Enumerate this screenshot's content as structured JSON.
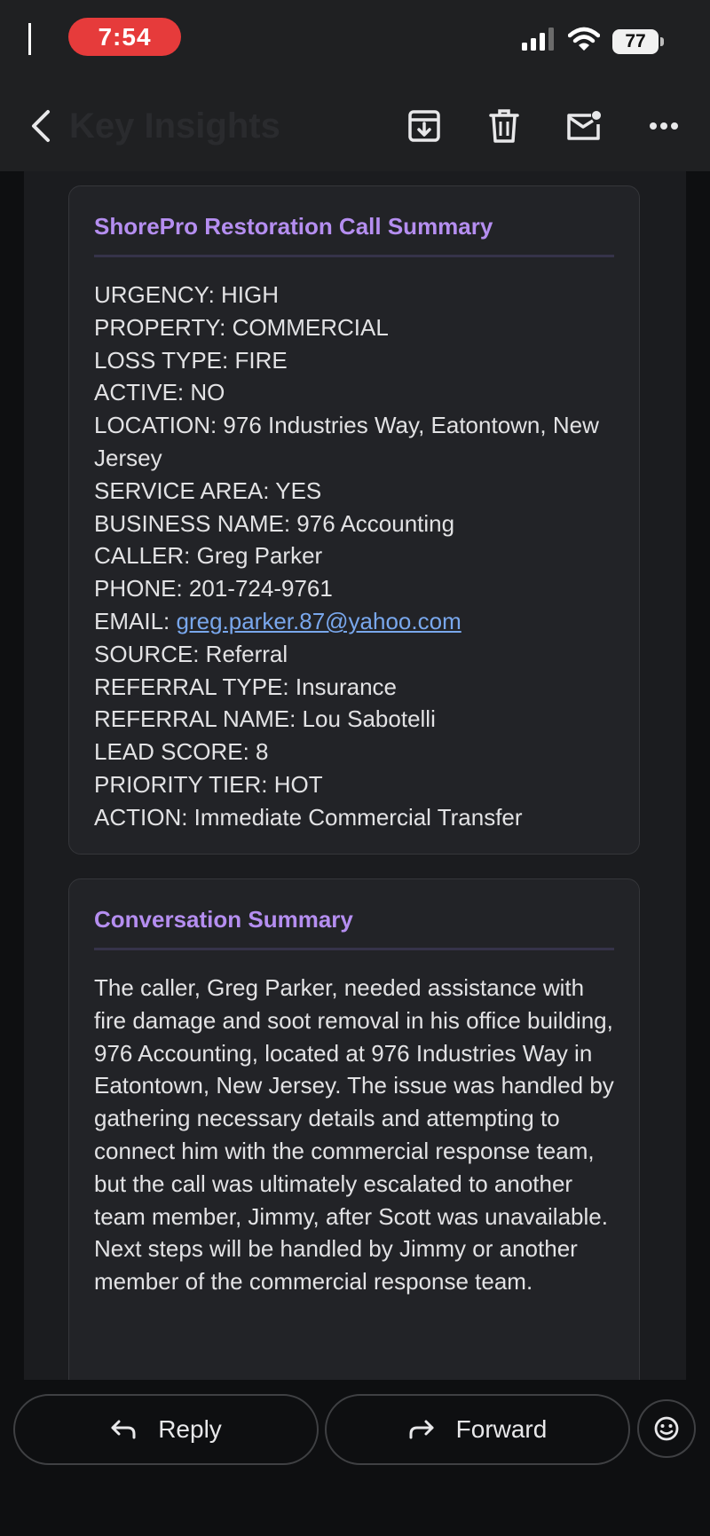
{
  "status_bar": {
    "time": "7:54",
    "battery": "77"
  },
  "toolbar": {
    "title": "Key Insights",
    "icons": [
      "back-arrow-icon",
      "archive-icon",
      "trash-icon",
      "mark-unread-icon",
      "more-icon"
    ]
  },
  "call_summary": {
    "title": "ShorePro Restoration Call Summary",
    "lines": [
      "URGENCY: HIGH",
      "PROPERTY: COMMERCIAL",
      "LOSS TYPE: FIRE",
      "ACTIVE: NO",
      "LOCATION: 976 Industries Way, Eatontown, New Jersey",
      "SERVICE AREA: YES",
      "BUSINESS NAME: 976 Accounting",
      "CALLER: Greg Parker",
      "PHONE: 201-724-9761"
    ],
    "email_label": "EMAIL: ",
    "email_value": "greg.parker.87@yahoo.com",
    "lines_after": [
      "SOURCE: Referral",
      "REFERRAL TYPE: Insurance",
      "REFERRAL NAME: Lou Sabotelli",
      "LEAD SCORE: 8",
      "PRIORITY TIER: HOT",
      "ACTION: Immediate Commercial Transfer"
    ]
  },
  "conversation_summary": {
    "title": "Conversation Summary",
    "text": "The caller, Greg Parker, needed assistance with fire damage and soot removal in his office building, 976 Accounting, located at 976 Industries Way in Eatontown, New Jersey. The issue was handled by gathering necessary details and attempting to connect him with the commercial response team, but the call was ultimately escalated to another team member, Jimmy, after Scott was unavailable. Next steps will be handled by Jimmy or another member of the commercial response team."
  },
  "actions": {
    "reply_label": "Reply",
    "forward_label": "Forward"
  },
  "colors": {
    "accent_title": "#b58ef0",
    "link": "#79a7ec",
    "time_pill": "#e63b3b"
  }
}
